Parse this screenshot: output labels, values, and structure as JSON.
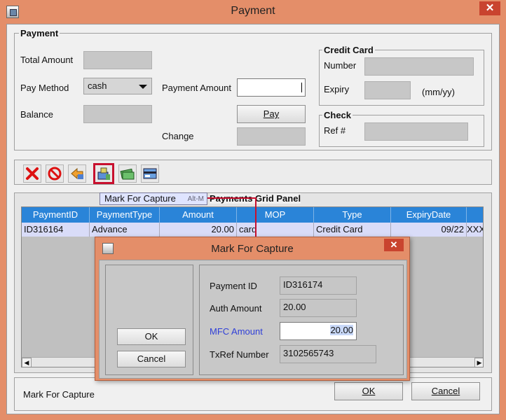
{
  "window": {
    "title": "Payment",
    "close": "✕"
  },
  "payment": {
    "group_title": "Payment",
    "total_amount_label": "Total Amount",
    "pay_method_label": "Pay Method",
    "pay_method_value": "cash",
    "balance_label": "Balance",
    "payment_amount_label": "Payment Amount",
    "pay_button": "Pay",
    "change_label": "Change"
  },
  "credit_card": {
    "group_title": "Credit Card",
    "number_label": "Number",
    "expiry_label": "Expiry",
    "expiry_hint": "(mm/yy)"
  },
  "check": {
    "group_title": "Check",
    "ref_label": "Ref #"
  },
  "tooltip": {
    "text": "Mark For Capture",
    "accelerator": "Alt-M"
  },
  "grid": {
    "title": "Payments Grid Panel",
    "columns": [
      "PaymentID",
      "PaymentType",
      "Amount",
      "MOP",
      "Type",
      "ExpiryDate",
      ""
    ],
    "rows": [
      [
        "ID316164",
        "Advance",
        "20.00",
        "card",
        "Credit Card",
        "09/22",
        "XXX"
      ]
    ]
  },
  "status_bar": {
    "text": "Mark For Capture",
    "ok_button": "OK",
    "cancel_button": "Cancel"
  },
  "dialog": {
    "title": "Mark For Capture",
    "close": "✕",
    "ok_button": "OK",
    "cancel_button": "Cancel",
    "payment_id_label": "Payment ID",
    "payment_id_value": "ID316174",
    "auth_amount_label": "Auth Amount",
    "auth_amount_value": "20.00",
    "mfc_amount_label": "MFC Amount",
    "mfc_amount_value": "20.00",
    "txref_label": "TxRef Number",
    "txref_value": "3102565743"
  },
  "colors": {
    "titlebar": "#e48e69",
    "close": "#c9442f",
    "grid_header": "#2a84d8",
    "grid_row": "#d9dcf8",
    "mfc_label": "#2f3fd8",
    "highlight": "#c8102e"
  },
  "icons": [
    "delete-icon",
    "cancel-icon",
    "refresh-icon",
    "mark-capture-icon",
    "money-icon",
    "card-icon"
  ]
}
